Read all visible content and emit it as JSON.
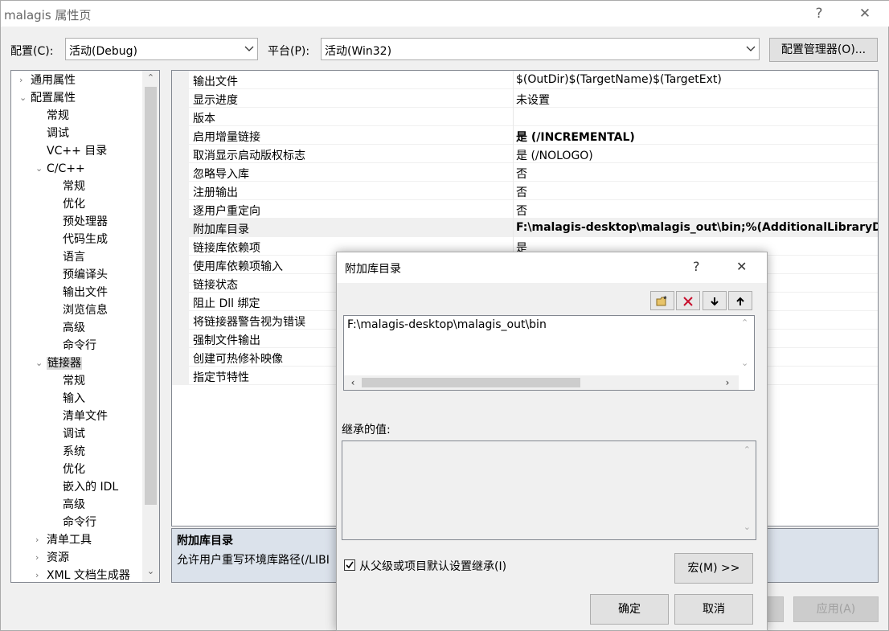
{
  "window": {
    "title": "malagis 属性页",
    "help": "?",
    "close": "✕"
  },
  "config": {
    "config_label": "配置(C):",
    "config_value": "活动(Debug)",
    "platform_label": "平台(P):",
    "platform_value": "活动(Win32)",
    "manager_button": "配置管理器(O)..."
  },
  "tree": {
    "items": [
      {
        "label": "通用属性",
        "chev": "›"
      },
      {
        "label": "配置属性",
        "chev": "⌄"
      },
      {
        "label": "常规"
      },
      {
        "label": "调试"
      },
      {
        "label": "VC++ 目录"
      },
      {
        "label": "C/C++",
        "chev": "⌄"
      },
      {
        "label": "常规"
      },
      {
        "label": "优化"
      },
      {
        "label": "预处理器"
      },
      {
        "label": "代码生成"
      },
      {
        "label": "语言"
      },
      {
        "label": "预编译头"
      },
      {
        "label": "输出文件"
      },
      {
        "label": "浏览信息"
      },
      {
        "label": "高级"
      },
      {
        "label": "命令行"
      },
      {
        "label": "链接器",
        "chev": "⌄"
      },
      {
        "label": "常规"
      },
      {
        "label": "输入"
      },
      {
        "label": "清单文件"
      },
      {
        "label": "调试"
      },
      {
        "label": "系统"
      },
      {
        "label": "优化"
      },
      {
        "label": "嵌入的 IDL"
      },
      {
        "label": "高级"
      },
      {
        "label": "命令行"
      },
      {
        "label": "清单工具",
        "chev": "›"
      },
      {
        "label": "资源",
        "chev": "›"
      },
      {
        "label": "XML 文档生成器",
        "chev": "›"
      }
    ]
  },
  "grid": {
    "rows": [
      {
        "name": "输出文件",
        "value": "$(OutDir)$(TargetName)$(TargetExt)"
      },
      {
        "name": "显示进度",
        "value": "未设置"
      },
      {
        "name": "版本",
        "value": ""
      },
      {
        "name": "启用增量链接",
        "value": "是 (/INCREMENTAL)"
      },
      {
        "name": "取消显示启动版权标志",
        "value": "是 (/NOLOGO)"
      },
      {
        "name": "忽略导入库",
        "value": "否"
      },
      {
        "name": "注册输出",
        "value": "否"
      },
      {
        "name": "逐用户重定向",
        "value": "否"
      },
      {
        "name": "附加库目录",
        "value": "F:\\malagis-desktop\\malagis_out\\bin;%(AdditionalLibraryDir"
      },
      {
        "name": "链接库依赖项",
        "value": "是"
      },
      {
        "name": "使用库依赖项输入",
        "value": ""
      },
      {
        "name": "链接状态",
        "value": ""
      },
      {
        "name": "阻止 Dll 绑定",
        "value": ""
      },
      {
        "name": "将链接器警告视为错误",
        "value": ""
      },
      {
        "name": "强制文件输出",
        "value": ""
      },
      {
        "name": "创建可热修补映像",
        "value": ""
      },
      {
        "name": "指定节特性",
        "value": ""
      }
    ]
  },
  "description": {
    "title": "附加库目录",
    "text": "允许用户重写环境库路径(/LIBI"
  },
  "bottom": {
    "apply_button": "应用(A)"
  },
  "dialog": {
    "title": "附加库目录",
    "help": "?",
    "close": "✕",
    "entries": [
      "F:\\malagis-desktop\\malagis_out\\bin"
    ],
    "inherited_label": "继承的值:",
    "inherit_checkbox_label": "从父级或项目默认设置继承(I)",
    "inherit_checked": true,
    "macro_button": "宏(M) >>",
    "ok_button": "确定",
    "cancel_button": "取消"
  }
}
